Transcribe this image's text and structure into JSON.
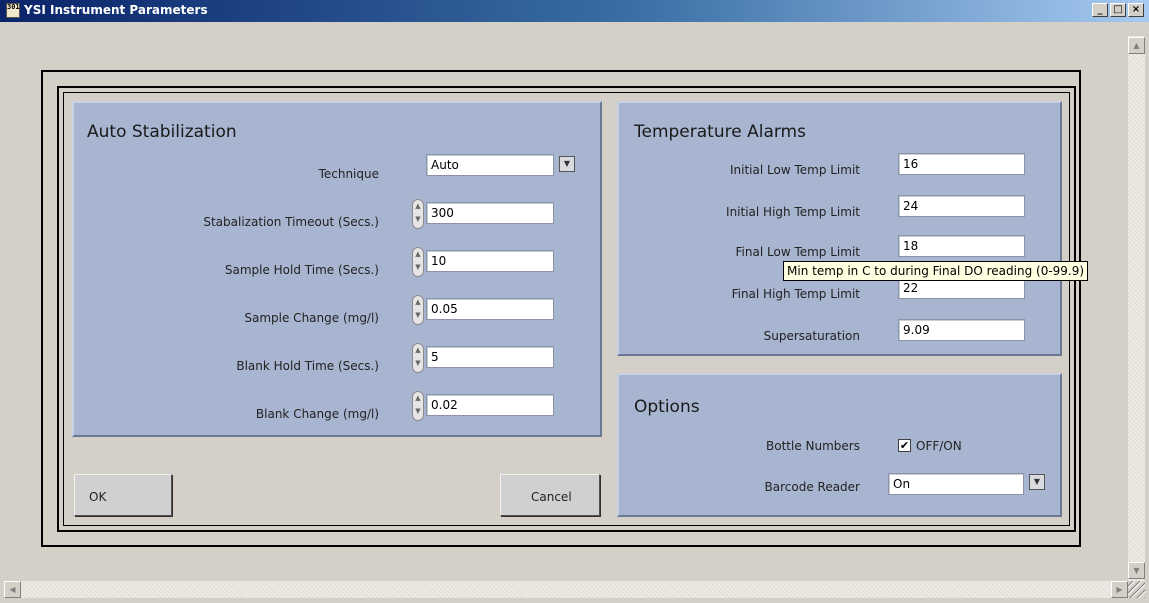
{
  "window": {
    "title": "YSI Instrument Parameters",
    "icon_glyph": "301",
    "buttons": {
      "minimize": "_",
      "maximize": "□",
      "close": "×"
    }
  },
  "auto_stabilization": {
    "title": "Auto Stabilization",
    "technique_label": "Technique",
    "technique_value": "Auto",
    "timeout_label": "Stabalization Timeout (Secs.)",
    "timeout_value": "300",
    "sample_hold_label": "Sample Hold Time (Secs.)",
    "sample_hold_value": "10",
    "sample_change_label": "Sample Change (mg/l)",
    "sample_change_value": "0.05",
    "blank_hold_label": "Blank Hold Time (Secs.)",
    "blank_hold_value": "5",
    "blank_change_label": "Blank Change (mg/l)",
    "blank_change_value": "0.02"
  },
  "temperature_alarms": {
    "title": "Temperature Alarms",
    "initial_low_label": "Initial Low Temp Limit",
    "initial_low_value": "16",
    "initial_high_label": "Initial High Temp Limit",
    "initial_high_value": "24",
    "final_low_label": "Final Low Temp Limit",
    "final_low_value": "18",
    "final_high_label": "Final High Temp Limit",
    "final_high_value": "22",
    "supersaturation_label": "Supersaturation",
    "supersaturation_value": "9.09"
  },
  "options": {
    "title": "Options",
    "bottle_numbers_label": "Bottle Numbers",
    "bottle_numbers_checked": true,
    "bottle_numbers_text": "OFF/ON",
    "barcode_label": "Barcode Reader",
    "barcode_value": "On"
  },
  "buttons": {
    "ok": "OK",
    "cancel": "Cancel"
  },
  "tooltip": "Min temp in C to during Final DO reading (0-99.9)",
  "glyphs": {
    "spin": "▲▼",
    "dropdown": "▼",
    "check": "✔",
    "scroll_up": "▲",
    "scroll_down": "▼",
    "scroll_left": "◀",
    "scroll_right": "▶"
  }
}
